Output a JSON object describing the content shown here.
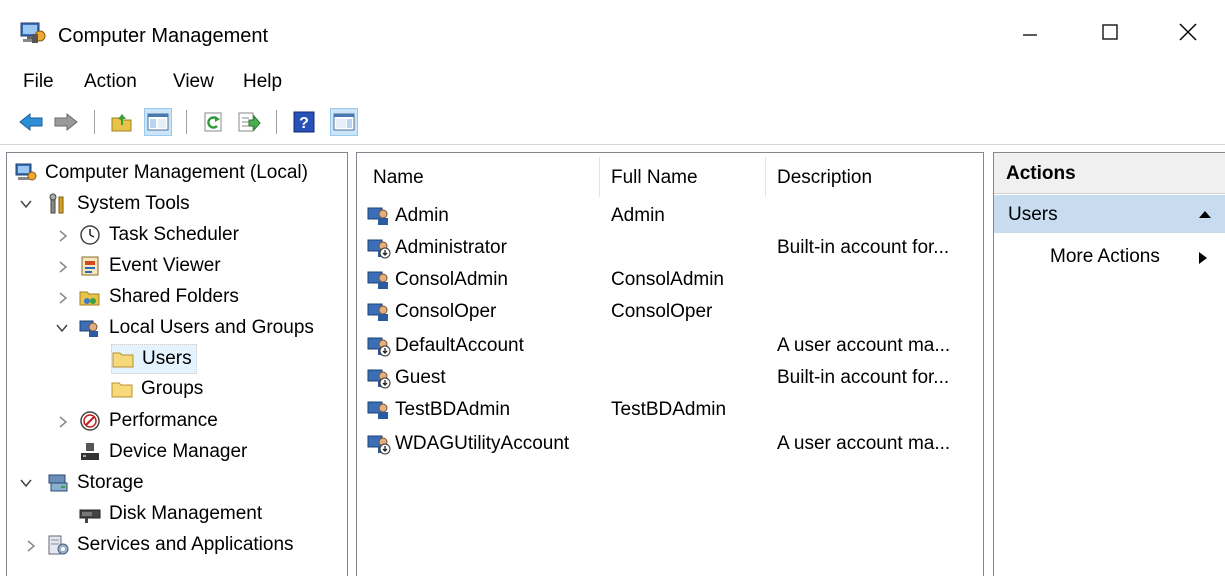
{
  "window": {
    "title": "Computer Management"
  },
  "menu": [
    "File",
    "Action",
    "View",
    "Help"
  ],
  "tree": {
    "root": "Computer Management (Local)",
    "system_tools": "System Tools",
    "task_scheduler": "Task Scheduler",
    "event_viewer": "Event Viewer",
    "shared_folders": "Shared Folders",
    "local_users_groups": "Local Users and Groups",
    "users": "Users",
    "groups": "Groups",
    "performance": "Performance",
    "device_manager": "Device Manager",
    "storage": "Storage",
    "disk_management": "Disk Management",
    "services_apps": "Services and Applications"
  },
  "list": {
    "columns": [
      "Name",
      "Full Name",
      "Description"
    ],
    "rows": [
      {
        "name": "Admin",
        "full_name": "Admin",
        "description": ""
      },
      {
        "name": "Administrator",
        "full_name": "",
        "description": "Built-in account for..."
      },
      {
        "name": "ConsolAdmin",
        "full_name": "ConsolAdmin",
        "description": ""
      },
      {
        "name": "ConsolOper",
        "full_name": "ConsolOper",
        "description": ""
      },
      {
        "name": "DefaultAccount",
        "full_name": "",
        "description": "A user account ma..."
      },
      {
        "name": "Guest",
        "full_name": "",
        "description": "Built-in account for..."
      },
      {
        "name": "TestBDAdmin",
        "full_name": "TestBDAdmin",
        "description": ""
      },
      {
        "name": "WDAGUtilityAccount",
        "full_name": "",
        "description": "A user account ma..."
      }
    ]
  },
  "actions": {
    "header": "Actions",
    "section": "Users",
    "more": "More Actions"
  }
}
